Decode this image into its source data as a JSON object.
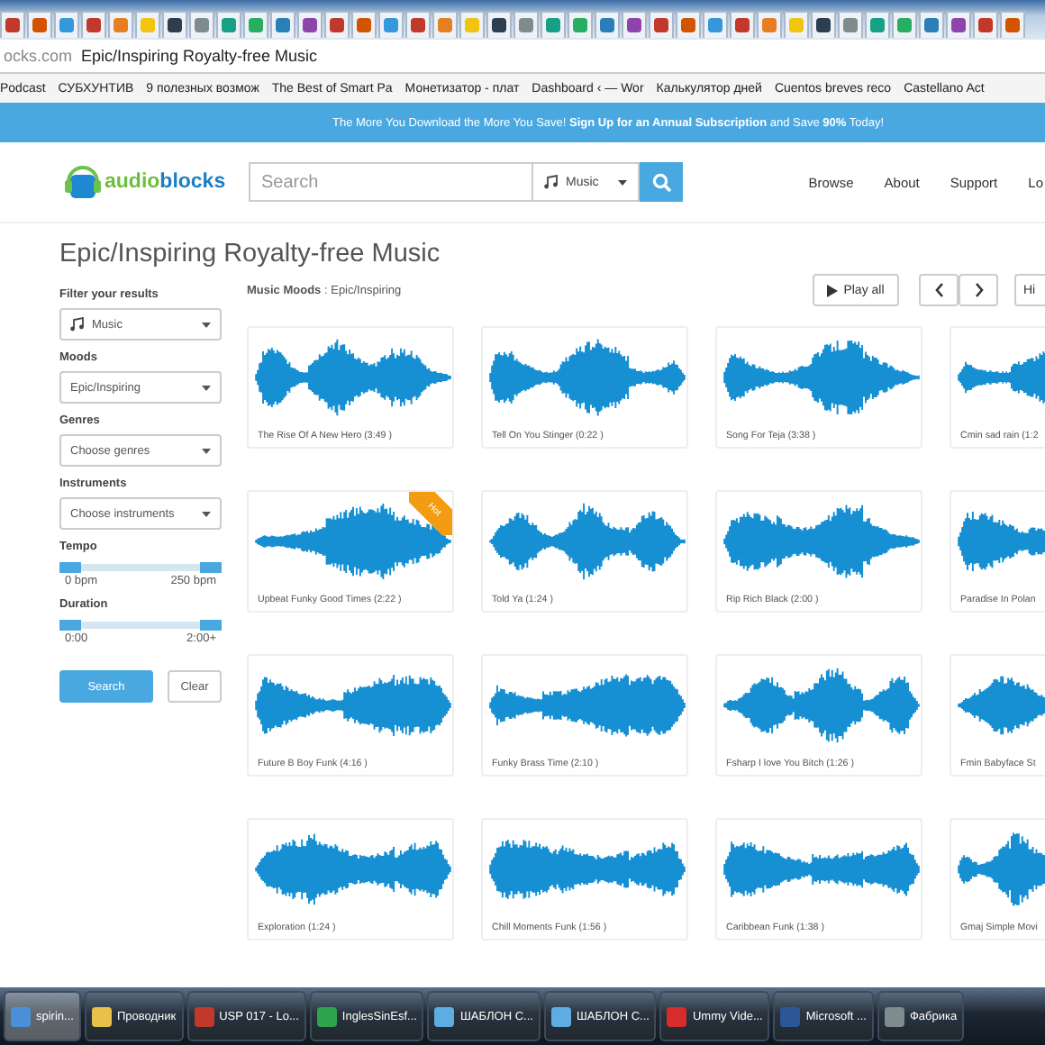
{
  "browser": {
    "address": {
      "domain": "ocks.com",
      "title": "Epic/Inspiring Royalty-free Music"
    },
    "bookmarks": [
      "Podcast",
      "СУБХУНТИВ",
      "9 полезных возмож",
      "The Best of Smart Pa",
      "Монетизатор - плат",
      "Dashboard ‹ — Wor",
      "Калькулятор дней",
      "Cuentos breves reco",
      "Castellano Act"
    ]
  },
  "banner": "The More You Download the More You Save! **Sign Up for an Annual Subscription** and Save **90%** Today!",
  "header": {
    "logo": {
      "part_1": "audio",
      "part_2": "blocks"
    },
    "search": {
      "placeholder": "Search",
      "category": "Music"
    },
    "nav": [
      "Browse",
      "About",
      "Support",
      "Lo"
    ]
  },
  "page_title": "Epic/Inspiring Royalty-free Music",
  "sidebar": {
    "title": "Filter your results",
    "type_select": "Music",
    "filters": [
      {
        "label": "Moods",
        "value": "Epic/Inspiring"
      },
      {
        "label": "Genres",
        "value": "Choose genres"
      },
      {
        "label": "Instruments",
        "value": "Choose instruments"
      }
    ],
    "ranges": [
      {
        "label": "Tempo",
        "min_label": "0 bpm",
        "max_label": "250 bpm",
        "handles": [
          {
            "level": 0
          },
          {
            "level": 1
          }
        ]
      },
      {
        "label": "Duration",
        "min_label": "0:00",
        "max_label": "2:00+",
        "handles": [
          {
            "level": 0
          },
          {
            "level": 1
          }
        ]
      }
    ],
    "buttons": [
      {
        "label": "Search",
        "kind": "primary"
      },
      {
        "label": "Clear",
        "kind": "default"
      }
    ]
  },
  "results": {
    "breadcrumb": "**Music**  **Moods** : Epic/Inspiring",
    "play_all": "Play all",
    "cut_button": "Hi",
    "tracks": [
      {
        "title": "The Rise Of A New Hero  (3:49 )"
      },
      {
        "title": "Tell On You Stinger (0:22 )"
      },
      {
        "title": "Song For Teja (3:38 )"
      },
      {
        "title": "Cmin sad rain (1:2"
      },
      {
        "title": "Upbeat Funky Good Times (2:22 )",
        "badge": "Hot"
      },
      {
        "title": "Told Ya (1:24 )"
      },
      {
        "title": "Rip Rich Black (2:00 )"
      },
      {
        "title": "Paradise In Polan"
      },
      {
        "title": "Future B Boy Funk (4:16 )"
      },
      {
        "title": "Funky Brass Time (2:10 )"
      },
      {
        "title": "Fsharp I love You Bitch (1:26 )"
      },
      {
        "title": "Fmin Babyface St"
      },
      {
        "title": "Exploration (1:24 )"
      },
      {
        "title": "Chill Moments Funk (1:56 )"
      },
      {
        "title": "Caribbean Funk (1:38 )"
      },
      {
        "title": "Gmaj Simple Movi"
      }
    ]
  },
  "taskbar": [
    {
      "label": "spirin...",
      "selected": true
    },
    {
      "label": "Проводник",
      "selected": false
    },
    {
      "label": "USP 017 - Lo...",
      "selected": false
    },
    {
      "label": "InglesSinEsf...",
      "selected": false
    },
    {
      "label": "ШАБЛОН С...",
      "selected": false
    },
    {
      "label": "ШАБЛОН С...",
      "selected": false
    },
    {
      "label": "Ummy Vide...",
      "selected": false
    },
    {
      "label": "Microsoft ...",
      "selected": false
    },
    {
      "label": "Фабрика",
      "selected": false
    }
  ]
}
